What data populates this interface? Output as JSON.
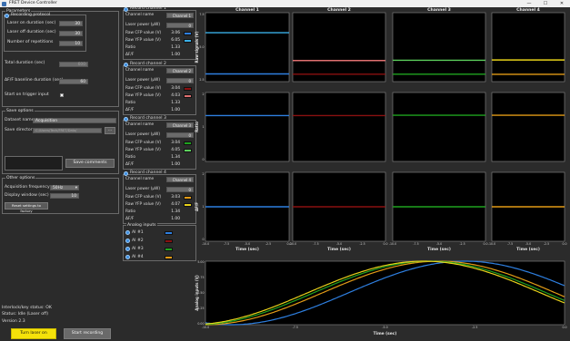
{
  "window": {
    "title": "FRET Device Controller",
    "minimize": "—",
    "maximize": "☐",
    "close": "✕"
  },
  "parameters": {
    "title": "Parameters",
    "recording_protocol_label": "Recording protocol",
    "laser_on_label": "Laser on duration (sec)",
    "laser_on_value": "30",
    "laser_off_label": "Laser off duration (sec)",
    "laser_off_value": "30",
    "repetitions_label": "Number of repetitions",
    "repetitions_value": "10",
    "total_duration_label": "Total duration (sec)",
    "total_duration_value": "600",
    "baseline_label": "ΔF/F baseline duration (sec)",
    "baseline_value": "60",
    "trigger_label": "Start on trigger input"
  },
  "save_options": {
    "title": "Save options",
    "dataset_label": "Dataset name",
    "dataset_value": "Acquisition",
    "directory_label": "Save directory",
    "directory_value": "C:/Users/Tech/FRET/Data/",
    "browse_label": "...",
    "save_comments_label": "Save comments"
  },
  "other_options": {
    "title": "Other options",
    "freq_label": "Acquisition frequency",
    "freq_value": "50Hz",
    "display_window_label": "Display window (sec)",
    "display_window_value": "10",
    "reset_label": "Reset settings to factory"
  },
  "status": {
    "interlock": "Interlock/key status: OK",
    "status": "Status: Idle (Laser off)",
    "version": "Version 2.3"
  },
  "buttons": {
    "turn_laser_on": "Turn laser on",
    "start_recording": "Start recording"
  },
  "record_channels": [
    {
      "title": "Record channel 1",
      "channel_name_label": "Channel name",
      "channel_name": "Channel 1",
      "laser_power_label": "Laser power (μW)",
      "laser_power": "0",
      "raw_cfp_label": "Raw CFP value (V)",
      "raw_cfp": "3.06",
      "cfp_color": "#2e7fe0",
      "raw_yfp_label": "Raw YFP value (V)",
      "raw_yfp": "6.05",
      "yfp_color": "#3ab0e8",
      "ratio_label": "Ratio",
      "ratio": "1.33",
      "dff_label": "ΔF/F",
      "dff": "1.00"
    },
    {
      "title": "Record channel 2",
      "channel_name_label": "Channel name",
      "channel_name": "Channel 2",
      "laser_power_label": "Laser power (μW)",
      "laser_power": "0",
      "raw_cfp_label": "Raw CFP value (V)",
      "raw_cfp": "3.04",
      "cfp_color": "#8a1010",
      "raw_yfp_label": "Raw YFP value (V)",
      "raw_yfp": "4.03",
      "yfp_color": "#e07070",
      "ratio_label": "Ratio",
      "ratio": "1.33",
      "dff_label": "ΔF/F",
      "dff": "1.00"
    },
    {
      "title": "Record channel 3",
      "channel_name_label": "Channel name",
      "channel_name": "Channel 3",
      "laser_power_label": "Laser power (μW)",
      "laser_power": "0",
      "raw_cfp_label": "Raw CFP value (V)",
      "raw_cfp": "3.04",
      "cfp_color": "#1fa31f",
      "raw_yfp_label": "Raw YFP value (V)",
      "raw_yfp": "4.05",
      "yfp_color": "#5cd05c",
      "ratio_label": "Ratio",
      "ratio": "1.34",
      "dff_label": "ΔF/F",
      "dff": "1.00"
    },
    {
      "title": "Record channel 4",
      "channel_name_label": "Channel name",
      "channel_name": "Channel 4",
      "laser_power_label": "Laser power (μW)",
      "laser_power": "0",
      "raw_cfp_label": "Raw CFP value (V)",
      "raw_cfp": "3.03",
      "cfp_color": "#e39b16",
      "raw_yfp_label": "Raw YFP value (V)",
      "raw_yfp": "4.07",
      "yfp_color": "#e8d21a",
      "ratio_label": "Ratio",
      "ratio": "1.34",
      "dff_label": "ΔF/F",
      "dff": "1.00"
    }
  ],
  "analog_inputs": {
    "title": "Analog inputs",
    "items": [
      {
        "label": "AI #1",
        "color": "#2e7fe0"
      },
      {
        "label": "AI #2",
        "color": "#8a1010"
      },
      {
        "label": "AI #3",
        "color": "#1fa31f"
      },
      {
        "label": "AI #4",
        "color": "#e39b16"
      }
    ]
  },
  "chart_data": [
    {
      "type": "line",
      "titles": [
        "Channel 1",
        "Channel 2",
        "Channel 3",
        "Channel 4"
      ],
      "rows": [
        {
          "ylabel": "Raw signals (V)",
          "ylim": [
            2.5,
            7.5
          ],
          "yticks": [
            "7.5",
            "5.0",
            "2.5"
          ],
          "series": [
            {
              "color": "#3ab0e8",
              "y": [
                6.05,
                4.03,
                4.05,
                4.07
              ]
            },
            {
              "color": "#2e7fe0",
              "y": [
                3.06,
                3.04,
                3.04,
                3.03
              ]
            }
          ]
        },
        {
          "ylabel": "Ratio",
          "ylim": [
            0,
            2
          ],
          "yticks": [
            "2",
            "1",
            "0"
          ],
          "values": [
            1.33,
            1.33,
            1.34,
            1.34
          ]
        },
        {
          "ylabel": "ΔF/F",
          "ylim": [
            0,
            2
          ],
          "yticks": [
            "2",
            "1",
            "0"
          ],
          "values": [
            1.0,
            1.0,
            1.0,
            1.0
          ]
        }
      ],
      "line_colors": [
        {
          "raw_hi": "#3ab0e8",
          "raw_lo": "#2e7fe0",
          "ratio": "#2e7fe0",
          "dff": "#2e7fe0"
        },
        {
          "raw_hi": "#e07070",
          "raw_lo": "#8a1010",
          "ratio": "#8a1010",
          "dff": "#8a1010"
        },
        {
          "raw_hi": "#5cd05c",
          "raw_lo": "#1fa31f",
          "ratio": "#1fa31f",
          "dff": "#1fa31f"
        },
        {
          "raw_hi": "#e8d21a",
          "raw_lo": "#e39b16",
          "ratio": "#e39b16",
          "dff": "#e39b16"
        }
      ],
      "xlabel": "Time (sec)",
      "xticks": [
        "-10.0",
        "-7.5",
        "-5.0",
        "-2.5",
        "0.0"
      ],
      "xlim": [
        -10,
        0
      ]
    },
    {
      "type": "line",
      "ylabel": "Analog inputs (V)",
      "xlabel": "Time (sec)",
      "xlim": [
        -10,
        0
      ],
      "ylim": [
        0,
        5
      ],
      "yticks": [
        "5.00",
        "3.75",
        "2.50",
        "1.25",
        "0.00"
      ],
      "xticks": [
        "-10.0",
        "-7.5",
        "-5.0",
        "-2.5",
        "0.0"
      ],
      "series": [
        {
          "color": "#2e7fe0",
          "amplitude": 2.5,
          "offset": 2.5,
          "period": 13,
          "phase": -0.35
        },
        {
          "color": "#e39b16",
          "amplitude": 2.5,
          "offset": 2.5,
          "period": 13,
          "phase": 0
        },
        {
          "color": "#1fa31f",
          "amplitude": 2.5,
          "offset": 2.5,
          "period": 13,
          "phase": 0.12
        },
        {
          "color": "#e8d21a",
          "amplitude": 2.5,
          "offset": 2.5,
          "period": 13,
          "phase": 0.2
        }
      ]
    }
  ]
}
